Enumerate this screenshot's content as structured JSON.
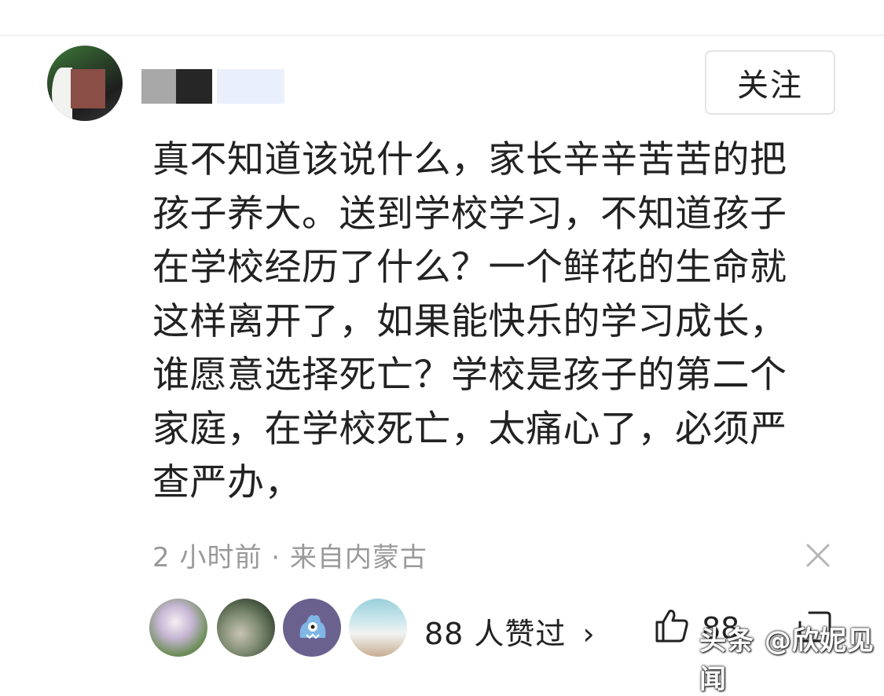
{
  "header": {
    "follow_label": "关注"
  },
  "comment": {
    "text": "真不知道该说什么，家长辛辛苦苦的把孩子养大。送到学校学习，不知道孩子在学校经历了什么？一个鲜花的生命就这样离开了，如果能快乐的学习成长，谁愿意选择死亡？学校是孩子的第二个家庭，在学校死亡，太痛心了，必须严查严办，",
    "meta": "2 小时前 · 来自内蒙古"
  },
  "likes": {
    "summary": "88 人赞过",
    "chevron": "›",
    "count": "88"
  },
  "watermark": {
    "text": "头条 @欣妮见闻"
  },
  "icons": [
    "close-icon",
    "thumbs-up-icon",
    "share-icon"
  ]
}
